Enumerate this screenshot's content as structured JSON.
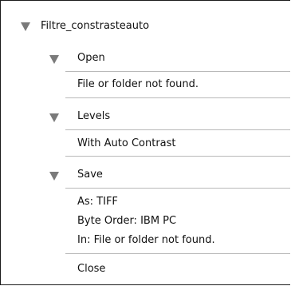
{
  "action_set": {
    "name": "Filtre_constrasteauto",
    "steps": [
      {
        "title": "Open",
        "details": [
          "File or folder not found."
        ]
      },
      {
        "title": "Levels",
        "details": [
          "With Auto Contrast"
        ]
      },
      {
        "title": "Save",
        "details": [
          "As: TIFF",
          "Byte Order: IBM PC",
          "In: File or folder not found."
        ]
      },
      {
        "title": "Close",
        "details": []
      }
    ]
  },
  "colors": {
    "triangle": "#7a7a7a",
    "border": "#1a1a1a",
    "separator": "#b9b9b9",
    "text": "#111111"
  }
}
